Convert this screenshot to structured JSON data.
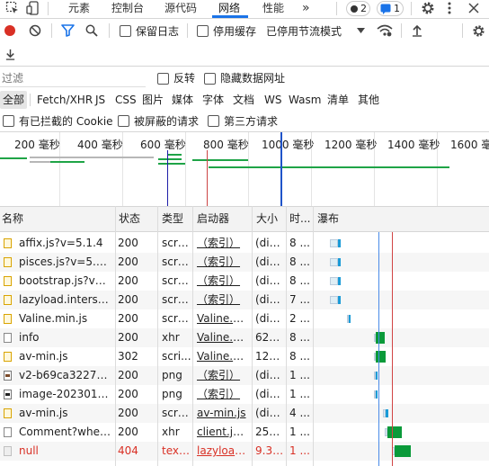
{
  "tabs": [
    {
      "label": "元素"
    },
    {
      "label": "控制台"
    },
    {
      "label": "源代码"
    },
    {
      "label": "网络",
      "active": true
    },
    {
      "label": "性能"
    }
  ],
  "more_tabs": "»",
  "badges": {
    "errors": "2",
    "messages": "1"
  },
  "toolbar": {
    "preserve_log_label": "保留日志",
    "disable_cache_label": "停用缓存",
    "throttle_value": "已停用节流模式"
  },
  "filter": {
    "placeholder": "过滤",
    "invert_label": "反转",
    "hide_data_urls_label": "隐藏数据网址"
  },
  "type_filters": [
    "全部",
    "Fetch/XHR",
    "JS",
    "CSS",
    "图片",
    "媒体",
    "字体",
    "文档",
    "WS",
    "Wasm",
    "清单",
    "其他"
  ],
  "cookie_filters": {
    "blocked_cookies_label": "有已拦截的 Cookie",
    "blocked_requests_label": "被屏蔽的请求",
    "third_party_label": "第三方请求"
  },
  "timeline": {
    "ticks": [
      "200 毫秒",
      "400 毫秒",
      "600 毫秒",
      "800 毫秒",
      "1000 毫秒",
      "1200 毫秒",
      "1400 毫秒",
      "1600 毫秒"
    ]
  },
  "table": {
    "headers": {
      "name": "名称",
      "status": "状态",
      "type": "类型",
      "initiator": "启动器",
      "size": "大小",
      "time": "时...",
      "waterfall": "瀑布"
    },
    "rows": [
      {
        "name": "affix.js?v=5.1.4",
        "status": "200",
        "type": "script",
        "initiator": "（索引）",
        "size": "(dis...",
        "time": "8 ...",
        "icon": "js"
      },
      {
        "name": "pisces.js?v=5.1.4",
        "status": "200",
        "type": "script",
        "initiator": "（索引）",
        "size": "(dis...",
        "time": "8 ...",
        "icon": "js"
      },
      {
        "name": "bootstrap.js?v=5...",
        "status": "200",
        "type": "script",
        "initiator": "（索引）",
        "size": "(dis...",
        "time": "8 ...",
        "icon": "js"
      },
      {
        "name": "lazyload.intersect...",
        "status": "200",
        "type": "script",
        "initiator": "（索引）",
        "size": "(dis...",
        "time": "7 ...",
        "icon": "js"
      },
      {
        "name": "Valine.min.js",
        "status": "200",
        "type": "script",
        "initiator": "Valine.mi...",
        "size": "(dis...",
        "time": "2 ...",
        "icon": "js"
      },
      {
        "name": "info",
        "status": "200",
        "type": "xhr",
        "initiator": "Valine.mi...",
        "size": "626...",
        "time": "8 ...",
        "icon": "doc"
      },
      {
        "name": "av-min.js",
        "status": "302",
        "type": "scri...",
        "initiator": "Valine.mi...",
        "size": "124...",
        "time": "8 ...",
        "icon": "js"
      },
      {
        "name": "v2-b69ca3227c4c...",
        "status": "200",
        "type": "png",
        "initiator": "（索引）",
        "size": "(dis...",
        "time": "1 ...",
        "icon": "img"
      },
      {
        "name": "image-20230116...",
        "status": "200",
        "type": "png",
        "initiator": "（索引）",
        "size": "(dis...",
        "time": "1 ...",
        "icon": "img2"
      },
      {
        "name": "av-min.js",
        "status": "200",
        "type": "script",
        "initiator": "av-min.js",
        "size": "(dis...",
        "time": "4 ...",
        "icon": "js"
      },
      {
        "name": "Comment?where...",
        "status": "200",
        "type": "xhr",
        "initiator": "client.js:...",
        "size": "259...",
        "time": "1 ...",
        "icon": "doc"
      },
      {
        "name": "null",
        "status": "404",
        "type": "text...",
        "initiator": "lazyload....",
        "size": "9.3 ...",
        "time": "1 ...",
        "icon": "err",
        "error": true
      }
    ]
  }
}
